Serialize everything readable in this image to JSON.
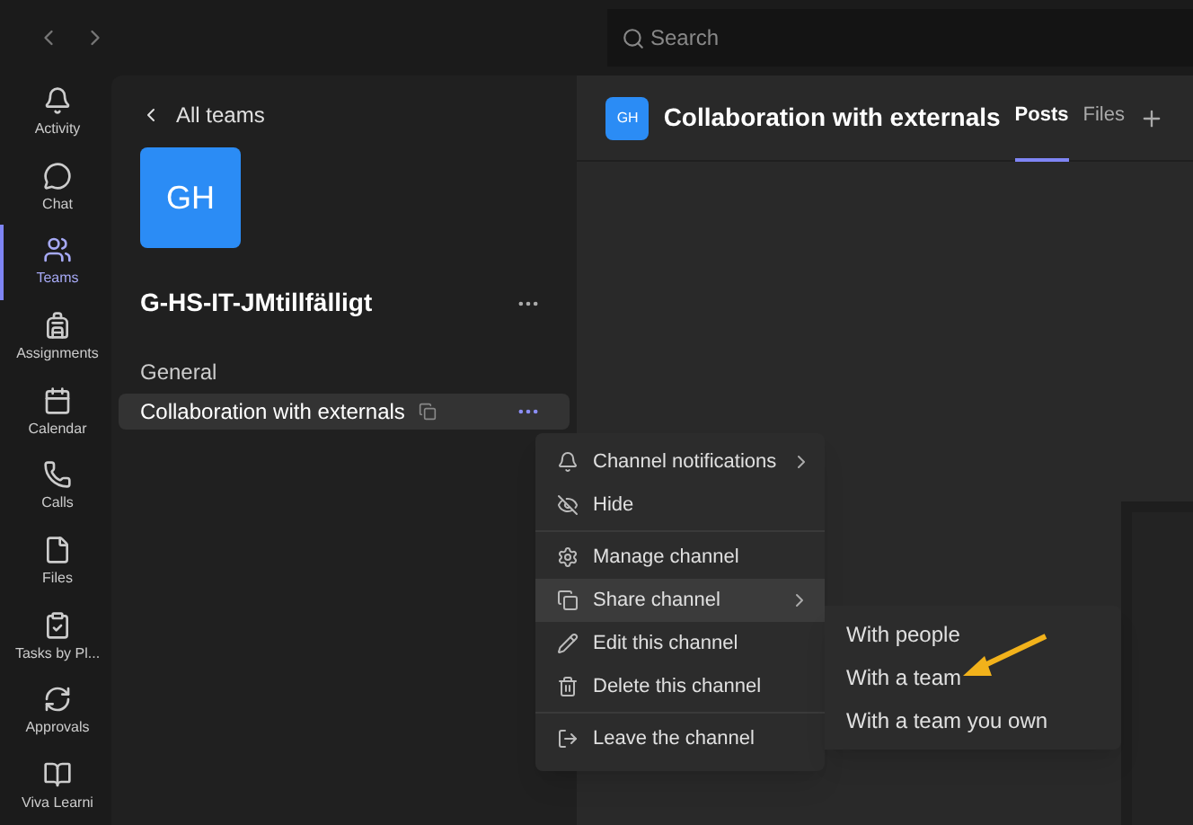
{
  "search": {
    "placeholder": "Search"
  },
  "rail": [
    {
      "label": "Activity",
      "kind": "activity",
      "selected": false
    },
    {
      "label": "Chat",
      "kind": "chat",
      "selected": false
    },
    {
      "label": "Teams",
      "kind": "teams",
      "selected": true
    },
    {
      "label": "Assignments",
      "kind": "assignments",
      "selected": false
    },
    {
      "label": "Calendar",
      "kind": "calendar",
      "selected": false
    },
    {
      "label": "Calls",
      "kind": "calls",
      "selected": false
    },
    {
      "label": "Files",
      "kind": "files",
      "selected": false
    },
    {
      "label": "Tasks by Pl...",
      "kind": "tasks",
      "selected": false
    },
    {
      "label": "Approvals",
      "kind": "approvals",
      "selected": false
    },
    {
      "label": "Viva Learni",
      "kind": "learning",
      "selected": false
    }
  ],
  "team_panel": {
    "back_label": "All teams",
    "avatar": "GH",
    "team_name": "G-HS-IT-JMtillfälligt",
    "channels": [
      {
        "name": "General",
        "shared": false,
        "selected": false
      },
      {
        "name": "Collaboration with externals",
        "shared": true,
        "selected": true
      }
    ]
  },
  "header": {
    "avatar": "GH",
    "title": "Collaboration with externals",
    "tabs": [
      {
        "label": "Posts",
        "selected": true
      },
      {
        "label": "Files",
        "selected": false
      }
    ]
  },
  "context_menu": {
    "groups": [
      [
        {
          "label": "Channel notifications",
          "kind": "bell",
          "submenu": true,
          "selected": false
        },
        {
          "label": "Hide",
          "kind": "hide",
          "submenu": false,
          "selected": false
        }
      ],
      [
        {
          "label": "Manage channel",
          "kind": "gear",
          "submenu": false,
          "selected": false
        },
        {
          "label": "Share channel",
          "kind": "share",
          "submenu": true,
          "selected": true
        },
        {
          "label": "Edit this channel",
          "kind": "pencil",
          "submenu": false,
          "selected": false
        },
        {
          "label": "Delete this channel",
          "kind": "trash",
          "submenu": false,
          "selected": false
        }
      ],
      [
        {
          "label": "Leave the channel",
          "kind": "leave",
          "submenu": false,
          "selected": false
        }
      ]
    ]
  },
  "submenu": [
    {
      "label": "With people"
    },
    {
      "label": "With a team"
    },
    {
      "label": "With a team you own"
    }
  ]
}
